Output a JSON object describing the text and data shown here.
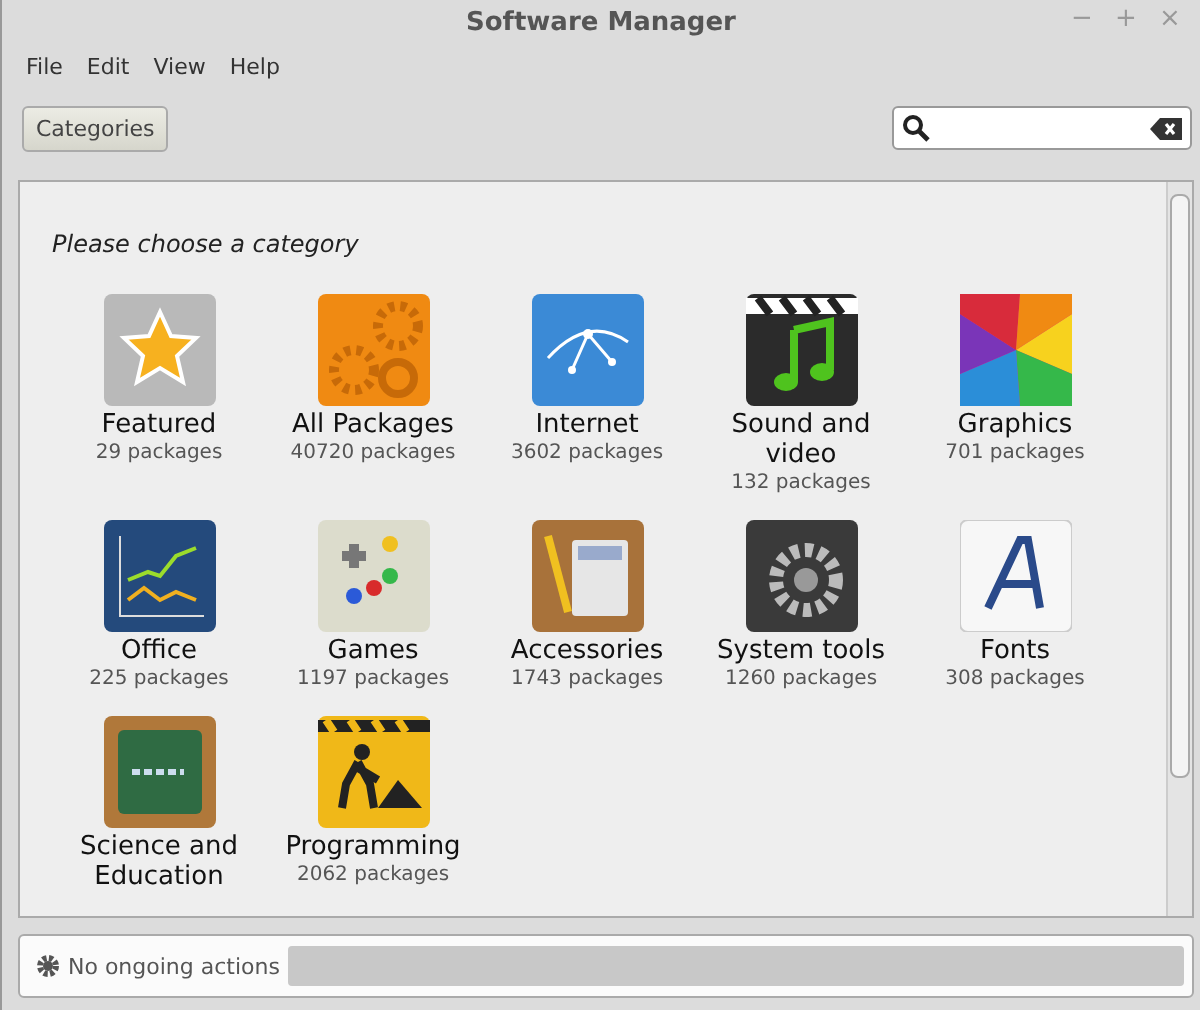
{
  "window": {
    "title": "Software Manager",
    "controls": [
      "−",
      "+",
      "×"
    ]
  },
  "menu": [
    "File",
    "Edit",
    "View",
    "Help"
  ],
  "toolbar": {
    "button": "Categories"
  },
  "heading": "Please choose a category",
  "categories": [
    {
      "name": "Featured",
      "count": "29 packages"
    },
    {
      "name": "All Packages",
      "count": "40720 packages"
    },
    {
      "name": "Internet",
      "count": "3602 packages"
    },
    {
      "name": "Sound and video",
      "count": "132 packages"
    },
    {
      "name": "Graphics",
      "count": "701 packages"
    },
    {
      "name": "Office",
      "count": "225 packages"
    },
    {
      "name": "Games",
      "count": "1197 packages"
    },
    {
      "name": "Accessories",
      "count": "1743 packages"
    },
    {
      "name": "System tools",
      "count": "1260 packages"
    },
    {
      "name": "Fonts",
      "count": "308 packages"
    },
    {
      "name": "Science and Education"
    },
    {
      "name": "Programming",
      "count": "2062 packages"
    }
  ],
  "status_bar": {
    "text": "No ongoing actions",
    "level": 0
  }
}
